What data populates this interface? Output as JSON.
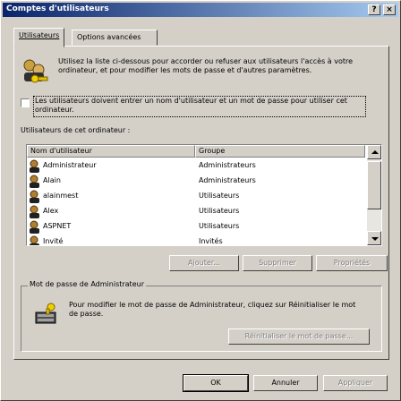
{
  "window": {
    "title": "Comptes d'utilisateurs",
    "help_button": "?",
    "close_button": "×"
  },
  "tabs": [
    {
      "label": "Utilisateurs",
      "active": true
    },
    {
      "label": "Options avancées",
      "active": false
    }
  ],
  "info": {
    "text": "Utilisez la liste ci-dessous pour accorder ou refuser aux utilisateurs l'accès à votre ordinateur, et pour modifier les mots de passe et d'autres paramètres."
  },
  "checkbox": {
    "checked": false,
    "label": "Les utilisateurs doivent entrer un nom d'utilisateur et un mot de passe pour utiliser cet ordinateur."
  },
  "users_section": {
    "title": "Utilisateurs de cet ordinateur :",
    "columns": [
      "Nom d'utilisateur",
      "Groupe"
    ],
    "rows": [
      {
        "name": "Administrateur",
        "group": "Administrateurs"
      },
      {
        "name": "Alain",
        "group": "Administrateurs"
      },
      {
        "name": "alainmest",
        "group": "Utilisateurs"
      },
      {
        "name": "Alex",
        "group": "Utilisateurs"
      },
      {
        "name": "ASPNET",
        "group": "Utilisateurs"
      },
      {
        "name": "Invité",
        "group": "Invités"
      }
    ]
  },
  "list_buttons": {
    "add": "Ajouter...",
    "delete": "Supprimer",
    "properties": "Propriétés"
  },
  "admin_password": {
    "title": "Mot de passe de Administrateur",
    "text": "Pour modifier le mot de passe de Administrateur, cliquez sur Réinitialiser le mot de passe.",
    "reset_button": "Réinitialiser le mot de passe..."
  },
  "dialog_buttons": {
    "ok": "OK",
    "cancel": "Annuler",
    "apply": "Appliquer"
  },
  "colors": {
    "title_gradient_start": "#0a246a",
    "title_gradient_end": "#a6caf0",
    "face": "#d4d0c8"
  }
}
